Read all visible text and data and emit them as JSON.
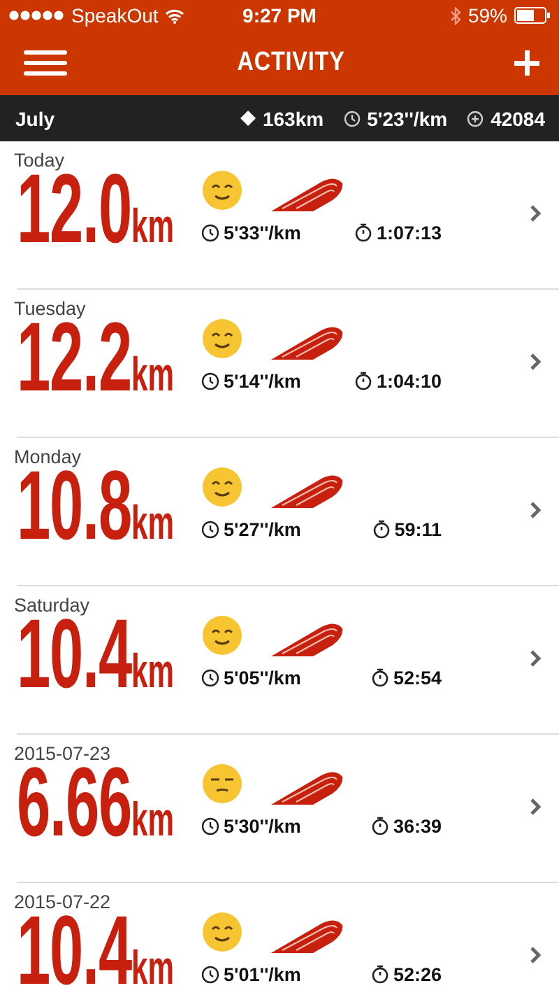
{
  "status_bar": {
    "carrier": "SpeakOut",
    "time": "9:27 PM",
    "battery": "59%"
  },
  "nav": {
    "title": "ACTIVITY"
  },
  "summary": {
    "month": "July",
    "distance": "163km",
    "pace": "5'23''/km",
    "fuel": "42084"
  },
  "runs": [
    {
      "date": "Today",
      "distance": "12.0",
      "unit": "km",
      "kind": "happy",
      "pace": "5'33''/km",
      "duration": "1:07:13"
    },
    {
      "date": "Tuesday",
      "distance": "12.2",
      "unit": "km",
      "kind": "happy",
      "pace": "5'14''/km",
      "duration": "1:04:10"
    },
    {
      "date": "Monday",
      "distance": "10.8",
      "unit": "km",
      "kind": "happy",
      "pace": "5'27''/km",
      "duration": "59:11"
    },
    {
      "date": "Saturday",
      "distance": "10.4",
      "unit": "km",
      "kind": "happy",
      "pace": "5'05''/km",
      "duration": "52:54"
    },
    {
      "date": "2015-07-23",
      "distance": "6.66",
      "unit": "km",
      "kind": "meh",
      "pace": "5'30''/km",
      "duration": "36:39"
    },
    {
      "date": "2015-07-22",
      "distance": "10.4",
      "unit": "km",
      "kind": "happy",
      "pace": "5'01''/km",
      "duration": "52:26"
    }
  ]
}
